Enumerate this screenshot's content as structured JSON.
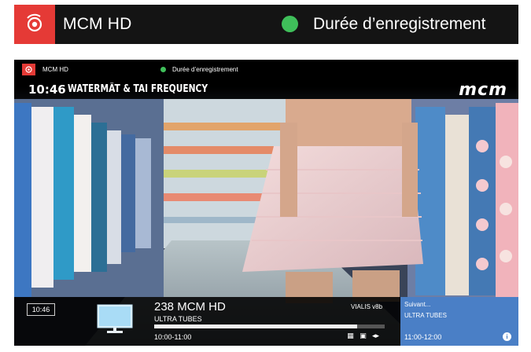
{
  "banner": {
    "channel": "MCM HD",
    "status": "Durée d’enregistrement",
    "record_color": "#e53a36",
    "status_color": "#3fbf5a",
    "record_icon": "record-icon"
  },
  "tv": {
    "header": {
      "channel": "MCM HD",
      "status": "Durée d’enregistrement",
      "program_time": "10:46",
      "program_title": "WATERMÄT & TAI FREQUENCY",
      "logo": "mcm"
    },
    "infobar": {
      "clock": "10:46",
      "channel_name": "238 MCM HD",
      "show": "ULTRA TUBES",
      "time_slot": "10:00-11:00",
      "provider": "VIALIS v8b",
      "progress": 0.88,
      "icons": [
        "hd-icon",
        "screen-icon",
        "audio-icon"
      ]
    },
    "next": {
      "label": "Suivant...",
      "show": "ULTRA TUBES",
      "time_slot": "11:00-12:00",
      "info_icon": "info-icon",
      "panel_color": "#4a7fc6"
    }
  }
}
